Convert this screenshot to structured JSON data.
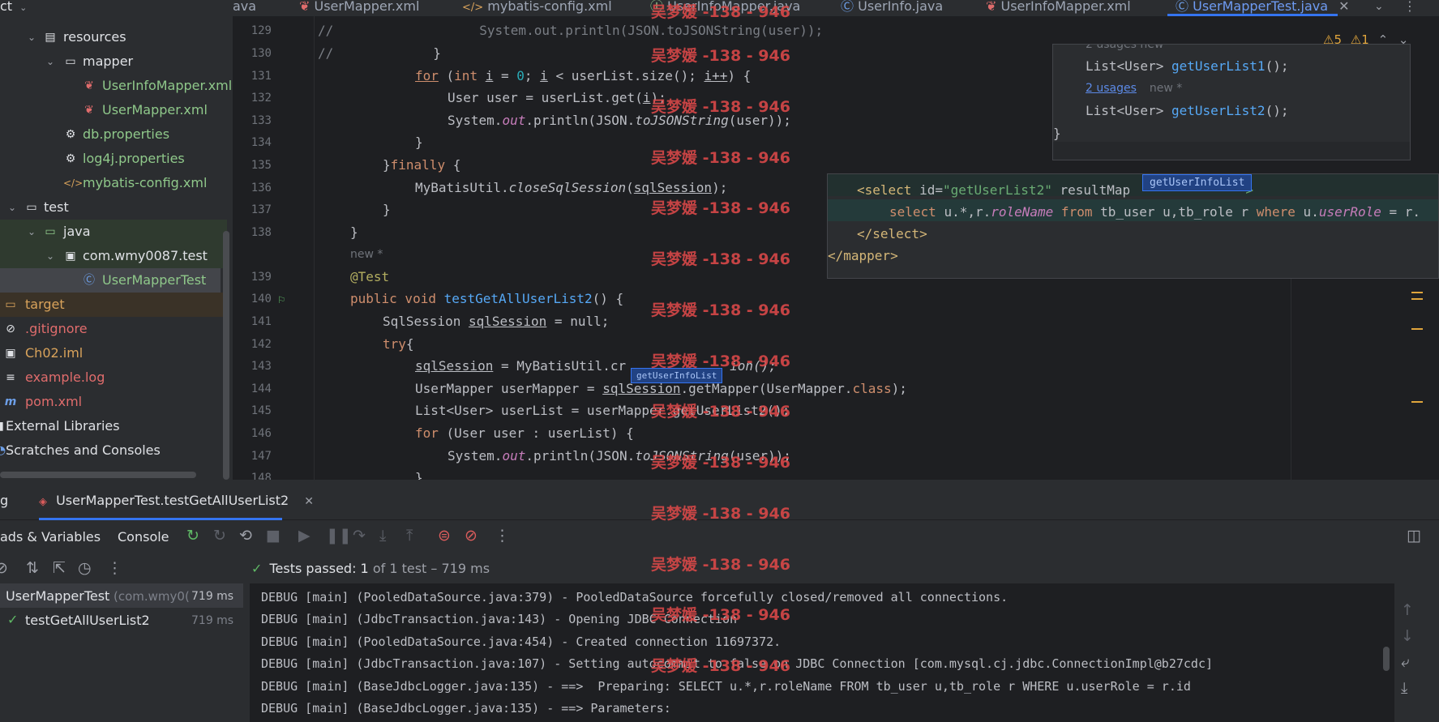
{
  "project": {
    "header": "ct",
    "items": [
      {
        "label": "resources",
        "color": "white",
        "icon": "folder-resources-icon",
        "expanded": true
      },
      {
        "label": "mapper",
        "color": "white",
        "icon": "folder-icon",
        "expanded": true
      },
      {
        "label": "UserInfoMapper.xml",
        "color": "green",
        "icon": "mybatis-xml-icon"
      },
      {
        "label": "UserMapper.xml",
        "color": "green",
        "icon": "mybatis-xml-icon"
      },
      {
        "label": "db.properties",
        "color": "green",
        "icon": "properties-icon"
      },
      {
        "label": "log4j.properties",
        "color": "green",
        "icon": "properties-icon"
      },
      {
        "label": "mybatis-config.xml",
        "color": "green",
        "icon": "xml-icon"
      },
      {
        "label": "test",
        "color": "white",
        "icon": "folder-icon",
        "expanded": true
      },
      {
        "label": "java",
        "color": "white",
        "icon": "folder-test-source-icon",
        "expanded": true
      },
      {
        "label": "com.wmy0087.test",
        "color": "white",
        "icon": "package-icon",
        "expanded": true
      },
      {
        "label": "UserMapperTest",
        "color": "green",
        "icon": "class-icon"
      },
      {
        "label": "target",
        "color": "orange",
        "icon": "folder-excluded-icon"
      },
      {
        "label": ".gitignore",
        "color": "red",
        "icon": "gitignore-icon"
      },
      {
        "label": "Ch02.iml",
        "color": "orange",
        "icon": "iml-icon"
      },
      {
        "label": "example.log",
        "color": "red",
        "icon": "log-icon"
      },
      {
        "label": "pom.xml",
        "color": "red",
        "icon": "maven-icon"
      },
      {
        "label": "External Libraries",
        "color": "white",
        "icon": "libraries-icon"
      },
      {
        "label": "Scratches and Consoles",
        "color": "white",
        "icon": "scratches-icon"
      }
    ]
  },
  "tabs": [
    {
      "label": "ava"
    },
    {
      "label": "UserMapper.xml",
      "icon": "mybatis-xml-icon"
    },
    {
      "label": "mybatis-config.xml",
      "icon": "xml-icon"
    },
    {
      "label": "UserInfoMapper.java",
      "icon": "interface-icon"
    },
    {
      "label": "UserInfo.java",
      "icon": "class-icon"
    },
    {
      "label": "UserInfoMapper.xml",
      "icon": "mybatis-xml-icon"
    },
    {
      "label": "UserMapperTest.java",
      "icon": "class-icon",
      "active": true
    }
  ],
  "editor": {
    "line_numbers": [
      "129",
      "130",
      "131",
      "132",
      "133",
      "134",
      "135",
      "136",
      "137",
      "138",
      "139",
      "140",
      "141",
      "142",
      "143",
      "144",
      "145",
      "146",
      "147",
      "148"
    ],
    "hint_new": "new *",
    "annotation": "@Test",
    "inspection": {
      "warnings": "5",
      "weak_warnings": "1"
    },
    "line129": "System.out.println(JSON.toJSONString(user));",
    "comment_marker": "//",
    "brace_close": "}",
    "for_kw": "for",
    "int_kw": "int",
    "var_i": "i",
    "zero": "0",
    "for_rest": " < userList.size(); ",
    "i_inc": "i++",
    "paren_brace": ") {",
    "user_decl": "User user = userList.get(",
    "get_close": ");",
    "sysout_a": "System.",
    "sysout_out": "out",
    "sysout_b": ".println(JSON.",
    "sysout_to": "toJSONString",
    "sysout_c": "(user));",
    "finally_kw": "finally",
    "finally_brace": " {",
    "close_a": "MyBatisUtil.",
    "close_fn": "closeSqlSession",
    "close_b": "(",
    "sql_session": "sqlSession",
    "public_void": "public void",
    "method_name": "testGetAllUserList2",
    "method_rest": "() {",
    "sess_decl": "SqlSession ",
    "sess_null": " = null;",
    "try_kw": "try",
    "try_brace": "{",
    "l143_b": " = MyBatisUtil.cr",
    "l143_c": "ion();",
    "l144_a": "UserMapper userMapper = ",
    "l144_b": "sqlSession",
    "l144_c": ".getMapper(UserMapper.",
    "class_kw": "class",
    "l144_d": ");",
    "l145": "List<User> userList = userMapper.getUserList2();",
    "for_each_a": " (User user : userList) {"
  },
  "popup_top": {
    "hint": "2 usages  new",
    "line1_a": "List<User> ",
    "line1_fn": "getUserList1",
    "line1_b": "();",
    "usages": "2 usages",
    "new": "new *",
    "line2_a": "List<User> ",
    "line2_fn": "getUserList2",
    "line2_b": "();",
    "close": "}"
  },
  "popup_xml": {
    "select_open_a": "<select ",
    "select_id_attr": "id=",
    "select_id_val": "\"getUserList2\"",
    "result_map": " resultMap",
    "result_tail": "\" >",
    "chip": "getUserInfoList",
    "sql_a": "select ",
    "sql_b": "u.*,r.",
    "sql_c": "roleName",
    "sql_from": " from ",
    "sql_d": "tb_user u,tb_role r ",
    "sql_where": "where",
    "sql_e": " u.",
    "sql_f": "userRole",
    "sql_g": " = r.",
    "select_close": "</select>",
    "mapper_close": "</mapper>"
  },
  "inline_chip": "getUserInfoList",
  "debug": {
    "tab_prefix": "g",
    "run_tab": "UserMapperTest.testGetAllUserList2",
    "threads_tab": "ads & Variables",
    "console_tab": "Console",
    "status_prefix": "Tests passed:",
    "status_count": "1",
    "status_rest": "of 1 test – 719 ms",
    "tree": [
      {
        "label": "UserMapperTest",
        "sub": "(com.wmy0(",
        "time": "719 ms"
      },
      {
        "label": "testGetAllUserList2",
        "time": "719 ms"
      }
    ],
    "console_lines": [
      "DEBUG [main] (PooledDataSource.java:379) - PooledDataSource forcefully closed/removed all connections.",
      "DEBUG [main] (JdbcTransaction.java:143) - Opening JDBC Connection",
      "DEBUG [main] (PooledDataSource.java:454) - Created connection 11697372.",
      "DEBUG [main] (JdbcTransaction.java:107) - Setting autocommit to false on JDBC Connection [com.mysql.cj.jdbc.ConnectionImpl@b27cdc]",
      "DEBUG [main] (BaseJdbcLogger.java:135) - ==>  Preparing: SELECT u.*,r.roleName FROM tb_user u,tb_role r WHERE u.userRole = r.id",
      "DEBUG [main] (BaseJdbcLogger.java:135) - ==> Parameters:"
    ]
  },
  "watermark": "吴梦媛 -138 - 946",
  "colors": {
    "accent": "#3574f0",
    "pass": "#5fb865"
  }
}
